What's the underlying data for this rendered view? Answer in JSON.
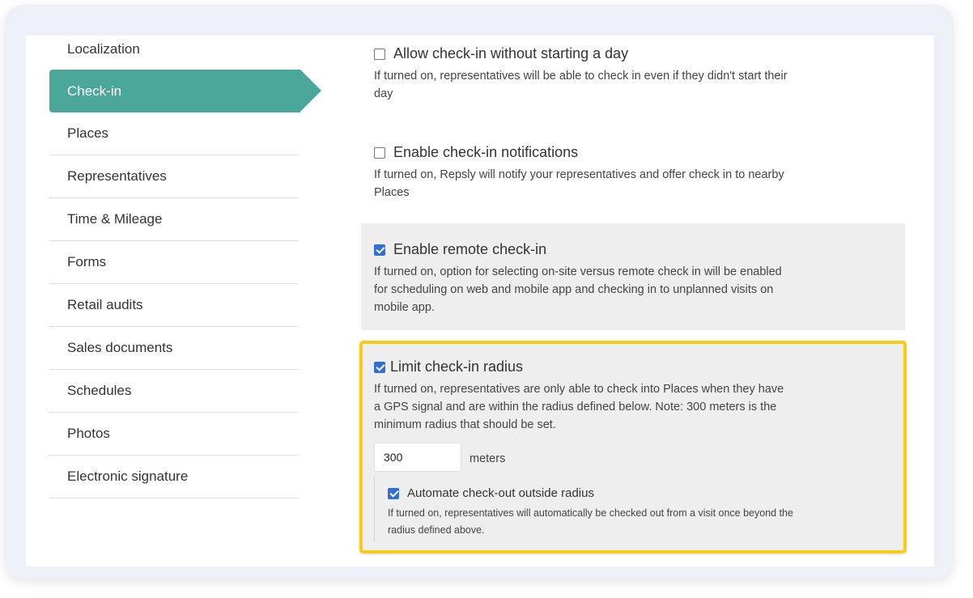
{
  "sidebar": {
    "items": [
      {
        "label": "Localization"
      },
      {
        "label": "Check-in",
        "active": true
      },
      {
        "label": "Places"
      },
      {
        "label": "Representatives"
      },
      {
        "label": "Time & Mileage"
      },
      {
        "label": "Forms"
      },
      {
        "label": "Retail audits"
      },
      {
        "label": "Sales documents"
      },
      {
        "label": "Schedules"
      },
      {
        "label": "Photos"
      },
      {
        "label": "Electronic signature"
      }
    ]
  },
  "settings": {
    "allow_without_day": {
      "label": "Allow check-in without starting a day",
      "description": "If turned on, representatives will be able to check in even if they didn't start their day",
      "checked": false
    },
    "notifications": {
      "label": "Enable check-in notifications",
      "description": "If turned on, Repsly will notify your representatives and offer check in to nearby Places",
      "checked": false
    },
    "remote": {
      "label": "Enable remote check-in",
      "description": "If turned on, option for selecting on-site versus remote check in will be enabled for scheduling on web and mobile app and checking in to unplanned visits on mobile app.",
      "checked": true
    },
    "limit_radius": {
      "label": "Limit check-in radius",
      "description": "If turned on, representatives are only able to check into Places when they have a GPS signal and are within the radius defined below. Note: 300 meters is the minimum radius that should be set.",
      "checked": true,
      "radius_value": "300",
      "radius_unit": "meters",
      "auto_checkout": {
        "label": "Automate check-out outside radius",
        "description": "If turned on, representatives will automatically be checked out from a visit once beyond the radius defined above.",
        "checked": true
      }
    }
  },
  "colors": {
    "active_nav": "#4aa79a",
    "highlight_border": "#f7cc12",
    "checkbox_checked": "#2f6fd6"
  }
}
